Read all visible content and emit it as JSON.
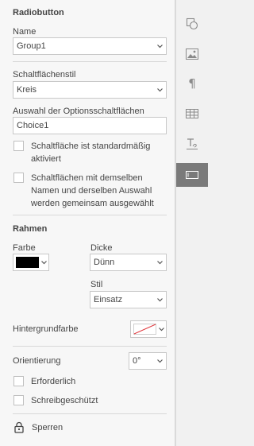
{
  "colors": {
    "panel_bg": "#f7f7f7",
    "rail_active": "#7a7a7a",
    "border": "#c8c8c8",
    "farbe_swatch": "#000000",
    "background_none_line": "#e0393e"
  },
  "section": {
    "title": "Radiobutton"
  },
  "name": {
    "label": "Name",
    "value": "Group1"
  },
  "style": {
    "label": "Schaltflächenstil",
    "value": "Kreis"
  },
  "choice": {
    "label": "Auswahl der Optionsschaltflächen",
    "value": "Choice1"
  },
  "default_checked": {
    "text_line1": "Schaltfläche ist standardmäßig",
    "text_line2": "aktiviert",
    "checked": false
  },
  "same_name": {
    "text_line1": "Schaltflächen mit demselben",
    "text_line2": "Namen und derselben Auswahl",
    "text_line3": "werden gemeinsam ausgewählt",
    "checked": false
  },
  "frame": {
    "title": "Rahmen",
    "color_label": "Farbe",
    "thickness_label": "Dicke",
    "thickness_value": "Dünn",
    "style_label": "Stil",
    "style_value": "Einsatz"
  },
  "background": {
    "label": "Hintergrundfarbe"
  },
  "orientation": {
    "label": "Orientierung",
    "value": "0°"
  },
  "required": {
    "label": "Erforderlich",
    "checked": false
  },
  "readonly": {
    "label": "Schreibgeschützt",
    "checked": false
  },
  "lock": {
    "label": "Sperren",
    "icon": "lock-icon"
  },
  "rail": [
    {
      "icon": "shape-settings-icon"
    },
    {
      "icon": "image-settings-icon"
    },
    {
      "icon": "paragraph-settings-icon"
    },
    {
      "icon": "table-settings-icon"
    },
    {
      "icon": "textart-settings-icon"
    },
    {
      "icon": "form-settings-icon",
      "active": true
    }
  ]
}
